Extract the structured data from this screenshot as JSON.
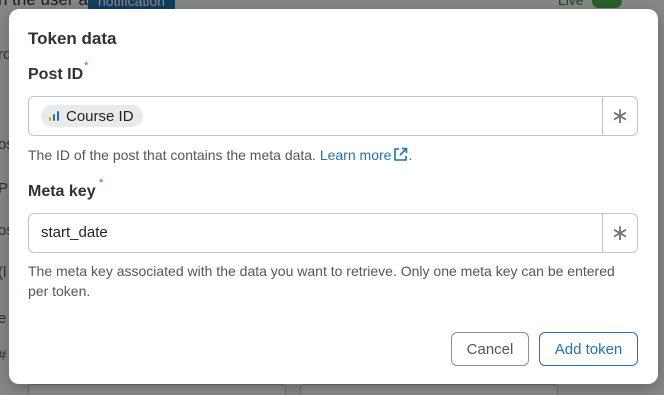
{
  "background": {
    "top_text": "n the user a",
    "chip_label": "notification",
    "live_label": "Live",
    "left_letters": [
      "rd",
      "os",
      "P",
      "os",
      "(l",
      "e",
      "#"
    ]
  },
  "modal": {
    "title": "Token data",
    "post_id": {
      "label": "Post ID",
      "required_mark": "*",
      "token_label": "Course ID",
      "token_icon": "bar-chart-icon",
      "side_icon": "asterisk-icon",
      "help_text": "The ID of the post that contains the meta data.",
      "help_link": "Learn more",
      "help_suffix": "."
    },
    "meta_key": {
      "label": "Meta key",
      "required_mark": "*",
      "value": "start_date",
      "side_icon": "asterisk-icon",
      "help_text": "The meta key associated with the data you want to retrieve. Only one meta key can be entered per token."
    },
    "buttons": {
      "cancel": "Cancel",
      "add": "Add token"
    }
  },
  "colors": {
    "accent": "#2271b1",
    "required": "#d63638",
    "token_bar_orange": "#f0a000",
    "token_bar_blue": "#2271b1"
  }
}
